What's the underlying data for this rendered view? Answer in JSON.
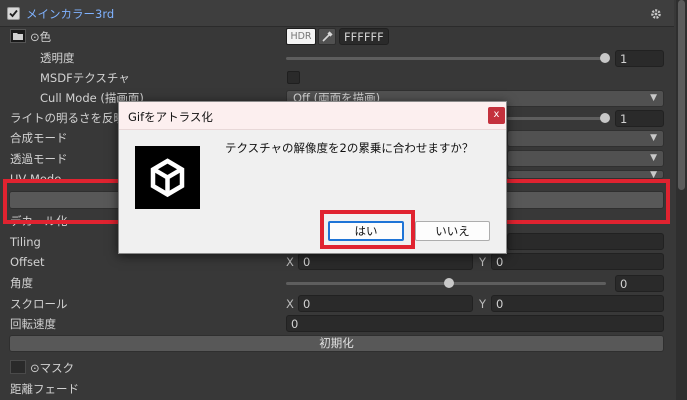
{
  "header": {
    "checkbox_checked": true,
    "title": "メインカラー3rd"
  },
  "color_row": {
    "label": "⊙色",
    "hdr_label": "HDR",
    "hex_value": "FFFFFF"
  },
  "rows": {
    "opacity": {
      "label": "透明度",
      "value": "1",
      "level": 1.0
    },
    "msdf": {
      "label": "MSDFテクスチャ"
    },
    "cull": {
      "label": "Cull Mode (描画面)",
      "value": "Off (両面を描画)"
    },
    "light": {
      "label": "ライトの明るさを反映",
      "value": "1"
    },
    "blend": {
      "label": "合成モード"
    },
    "transparency": {
      "label": "透過モード"
    },
    "uvmode": {
      "label": "UV Mode"
    },
    "decal": {
      "label": "デカール化"
    },
    "tiling": {
      "label": "Tiling"
    },
    "offset": {
      "label": "Offset",
      "x_axis": "X",
      "x_value": "0",
      "y_axis": "Y",
      "y_value": "0"
    },
    "angle": {
      "label": "角度",
      "value": "0",
      "level": 0.5
    },
    "scroll": {
      "label": "スクロール",
      "x_axis": "X",
      "x_value": "0",
      "y_axis": "Y",
      "y_value": "0"
    },
    "rotation": {
      "label": "回転速度",
      "value": "0"
    },
    "reset": {
      "label": "初期化"
    },
    "mask": {
      "label": "⊙マスク"
    },
    "distance_fade": {
      "label": "距離フェード"
    }
  },
  "dialog": {
    "title": "Gifをアトラス化",
    "close_label": "x",
    "message": "テクスチャの解像度を2の累乗に合わせますか？",
    "yes_label": "はい",
    "no_label": "いいえ"
  },
  "colors": {
    "highlight": "#e02330",
    "accent_title": "#7fb2ff",
    "dialog_bg": "#f0f0f0"
  }
}
